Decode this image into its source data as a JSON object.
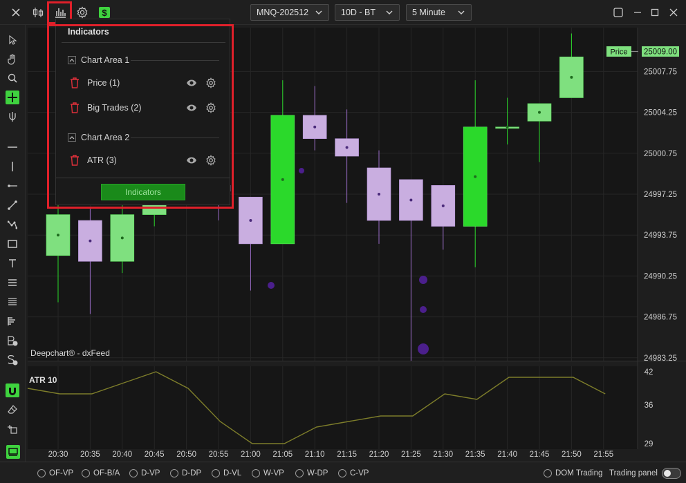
{
  "toolbar": {
    "instrument": "MNQ-202512",
    "timeframe": "10D - BT",
    "interval": "5 Minute"
  },
  "chart": {
    "watermark": "Deepchart® - dxFeed",
    "price_tag_label": "Price",
    "price_tag_value": "25009.00",
    "price_axis": [
      "25007.75",
      "25004.25",
      "25000.75",
      "24997.25",
      "24993.75",
      "24990.25",
      "24986.75",
      "24983.25"
    ],
    "time_axis": [
      "20:30",
      "20:35",
      "20:40",
      "20:45",
      "20:50",
      "20:55",
      "21:00",
      "21:05",
      "21:10",
      "21:15",
      "21:20",
      "21:25",
      "21:30",
      "21:35",
      "21:40",
      "21:45",
      "21:50",
      "21:55"
    ],
    "atr_title": "ATR 10",
    "atr_axis": [
      "42",
      "36",
      "29"
    ],
    "colors": {
      "up": "#2bd92b",
      "up_light": "#7fe07f",
      "down": "#9b6cc8",
      "down_light": "#c9aee0",
      "atr_line": "#7d7d2a",
      "price_tag": "#7ee07e"
    }
  },
  "chart_data": {
    "type": "candlestick",
    "candles": [
      {
        "time": "20:30",
        "open": 24992.0,
        "high": 24996.5,
        "low": 24988.0,
        "close": 24995.5
      },
      {
        "time": "20:35",
        "open": 24995.0,
        "high": 24996.0,
        "low": 24987.0,
        "close": 24991.5
      },
      {
        "time": "20:40",
        "open": 24991.5,
        "high": 24999.5,
        "low": 24990.5,
        "close": 24995.5
      },
      {
        "time": "20:45",
        "open": 24995.5,
        "high": 24998.0,
        "low": 24994.5,
        "close": 24998.0
      },
      {
        "time": "20:55",
        "open": 24998.0,
        "high": 25001.0,
        "low": 24995.0,
        "close": 24997.5
      },
      {
        "time": "21:00",
        "open": 24997.0,
        "high": 24997.0,
        "low": 24989.0,
        "close": 24993.0
      },
      {
        "time": "21:05",
        "open": 24993.0,
        "high": 25007.0,
        "low": 24993.0,
        "close": 25004.0
      },
      {
        "time": "21:10",
        "open": 25004.0,
        "high": 25006.5,
        "low": 25001.0,
        "close": 25002.0
      },
      {
        "time": "21:15",
        "open": 25002.0,
        "high": 25004.5,
        "low": 24996.5,
        "close": 25000.5
      },
      {
        "time": "21:20",
        "open": 24999.5,
        "high": 25001.0,
        "low": 24993.0,
        "close": 24995.0
      },
      {
        "time": "21:25",
        "open": 24998.5,
        "high": 24998.5,
        "low": 24983.0,
        "close": 24995.0
      },
      {
        "time": "21:30",
        "open": 24998.0,
        "high": 24998.0,
        "low": 24992.5,
        "close": 24994.5
      },
      {
        "time": "21:35",
        "open": 24994.5,
        "high": 25007.0,
        "low": 24991.0,
        "close": 25003.0
      },
      {
        "time": "21:40",
        "open": 25003.0,
        "high": 25005.5,
        "low": 25001.5,
        "close": 25003.0
      },
      {
        "time": "21:45",
        "open": 25003.5,
        "high": 25004.5,
        "low": 25000.0,
        "close": 25005.0
      },
      {
        "time": "21:50",
        "open": 25005.5,
        "high": 25011.0,
        "low": 25005.5,
        "close": 25009.0
      }
    ],
    "atr": {
      "name": "ATR 10",
      "points": [
        39,
        38,
        38,
        40,
        42,
        39,
        33,
        29,
        29,
        32,
        33,
        34,
        34,
        38,
        37,
        41,
        41,
        41,
        38
      ],
      "ylim": [
        29,
        42
      ]
    }
  },
  "indicators_popup": {
    "title": "Indicators",
    "areas": [
      {
        "label": "Chart Area 1",
        "items": [
          {
            "label": "Price (1)"
          },
          {
            "label": "Big Trades (2)"
          }
        ]
      },
      {
        "label": "Chart Area 2",
        "items": [
          {
            "label": "ATR (3)"
          }
        ]
      }
    ],
    "button_label": "Indicators"
  },
  "bottombar": {
    "radios": [
      "OF-VP",
      "OF-B/A",
      "D-VP",
      "D-DP",
      "D-VL",
      "W-VP",
      "W-DP",
      "C-VP",
      "DOM Trading"
    ],
    "trading_panel_label": "Trading panel"
  }
}
